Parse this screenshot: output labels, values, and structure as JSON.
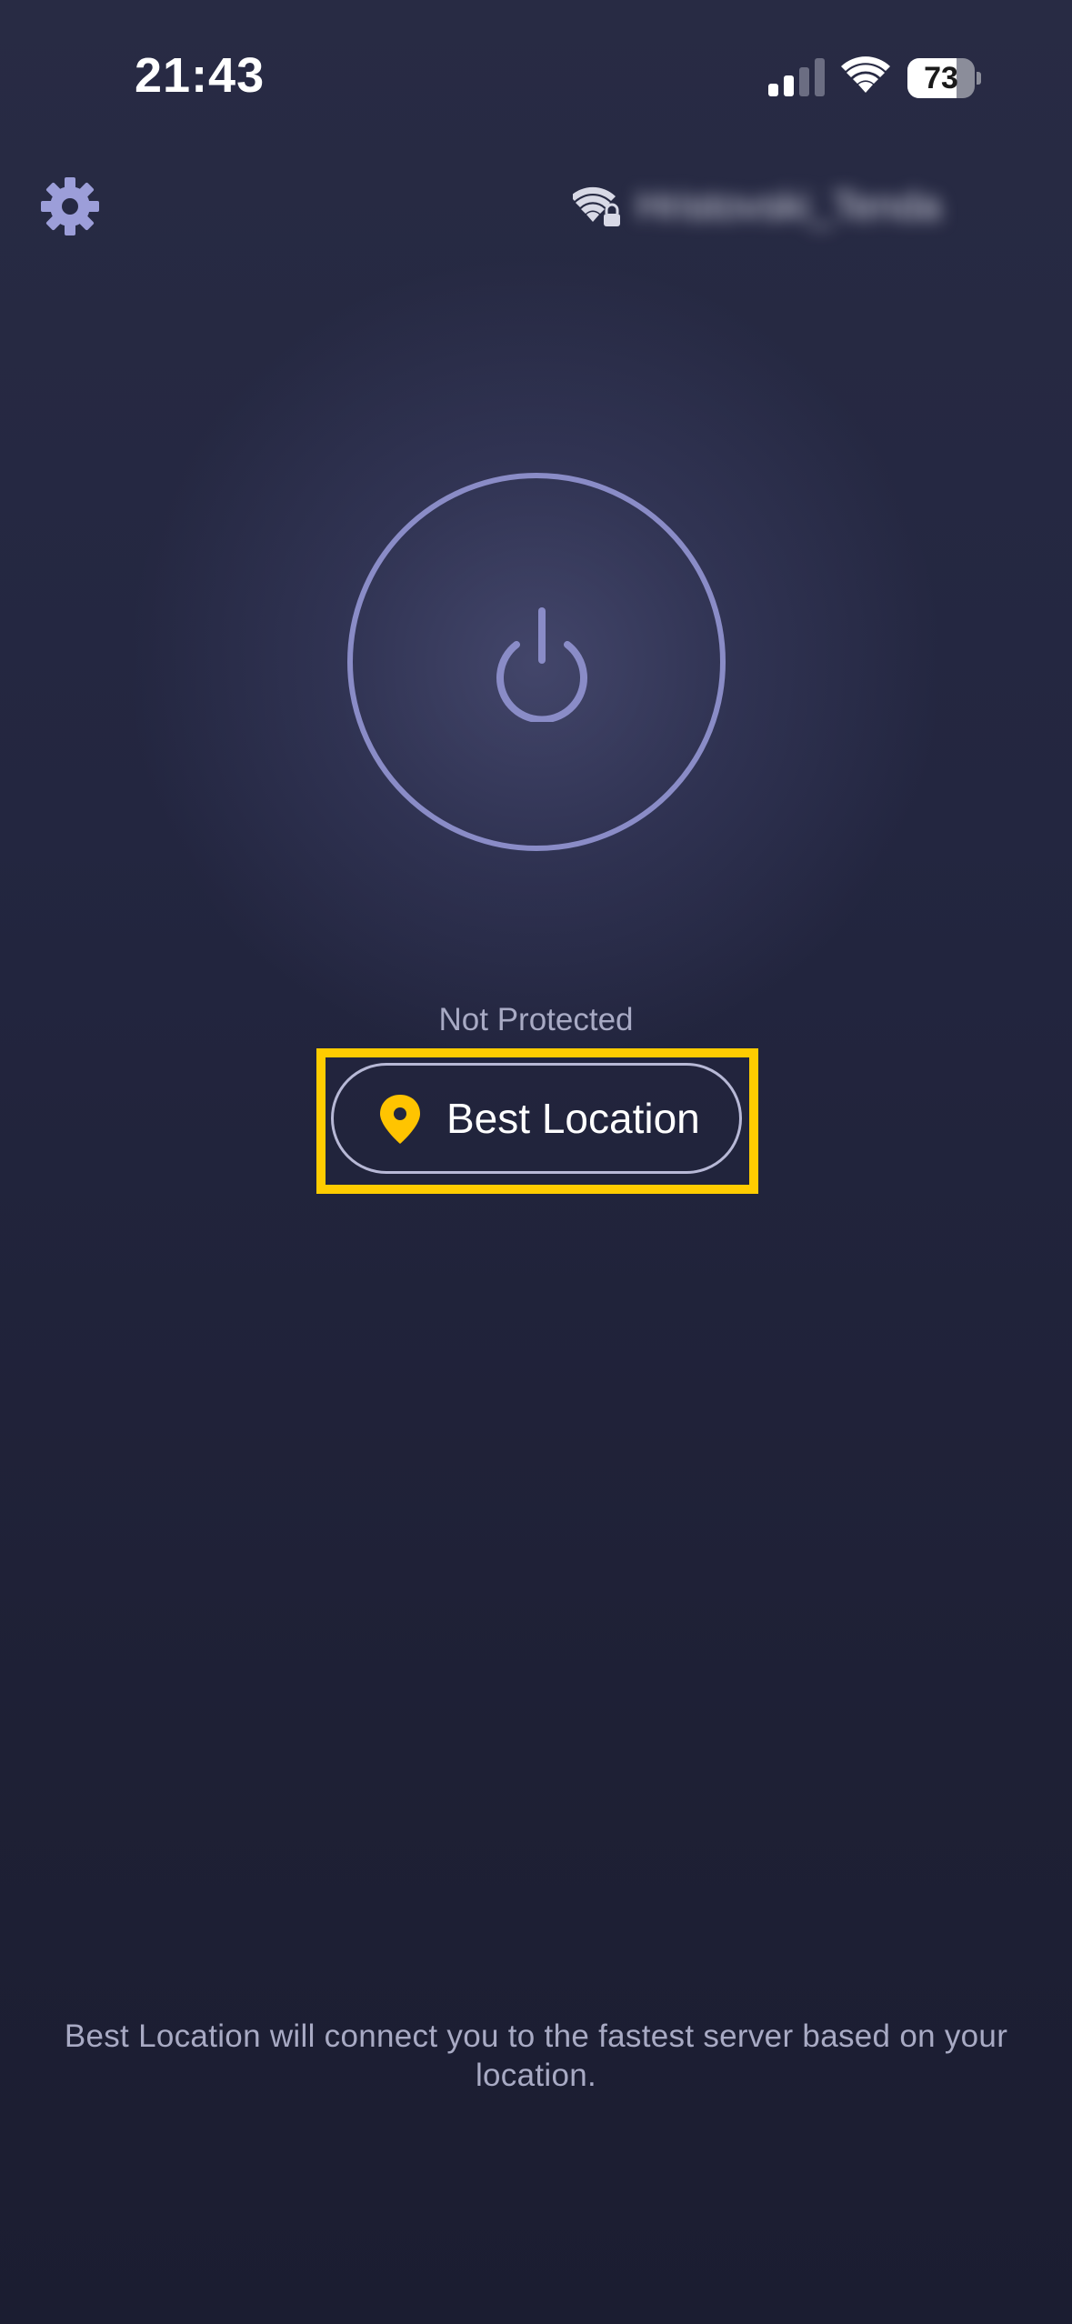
{
  "status_bar": {
    "time": "21:43",
    "battery_percent": "73",
    "battery_level": 0.73,
    "signal_bars_active": 2,
    "signal_bars_total": 4
  },
  "header": {
    "settings_icon": "gear-icon",
    "network_icon": "wifi-lock-icon",
    "network_name": "Hristovski_Tenda"
  },
  "main": {
    "power_icon": "power-icon",
    "status": "Not Protected",
    "location_icon": "map-pin-icon",
    "location_label": "Best Location"
  },
  "footer": {
    "info": "Best Location will connect you to the fastest server based on your location."
  },
  "colors": {
    "accent_ring": "#8a8cc7",
    "highlight": "#ffcc00",
    "pin": "#ffc400",
    "secondary_text": "#a8aac4"
  }
}
